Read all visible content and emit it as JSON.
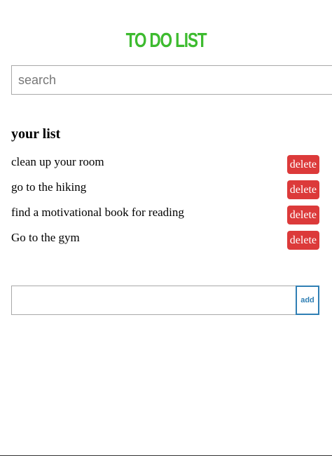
{
  "app": {
    "title": "TO DO LIST"
  },
  "search": {
    "placeholder": "search",
    "value": ""
  },
  "list_section": {
    "heading": "your list",
    "items": [
      {
        "text": "clean up your room",
        "delete_label": "delete"
      },
      {
        "text": "go to the hiking",
        "delete_label": "delete"
      },
      {
        "text": "find a motivational book for reading",
        "delete_label": "delete"
      },
      {
        "text": "Go to the gym",
        "delete_label": "delete"
      }
    ]
  },
  "add_form": {
    "value": "",
    "button_label": "add"
  },
  "colors": {
    "title": "#3dbb2f",
    "delete_button": "#dc3a3a",
    "add_button_border": "#2f7fb4"
  }
}
